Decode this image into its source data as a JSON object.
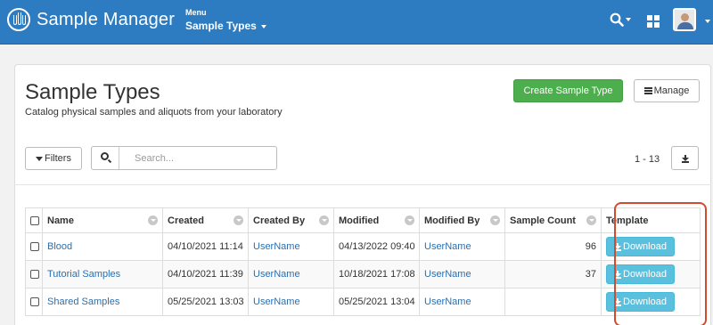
{
  "navbar": {
    "brand": "Sample Manager",
    "menu_label": "Menu",
    "menu_current": "Sample Types",
    "icons": [
      "search-icon",
      "apps-grid-icon",
      "user-avatar-icon"
    ]
  },
  "header": {
    "title": "Sample Types",
    "subtitle": "Catalog physical samples and aliquots from your laboratory",
    "create_button": "Create Sample Type",
    "manage_button": "Manage"
  },
  "toolbar": {
    "filters_label": "Filters",
    "search_placeholder": "Search...",
    "pagination": "1 - 13"
  },
  "table": {
    "columns": [
      "Name",
      "Created",
      "Created By",
      "Modified",
      "Modified By",
      "Sample Count",
      "Template"
    ],
    "rows": [
      {
        "name": "Blood",
        "created": "04/10/2021 11:14",
        "created_by": "UserName",
        "modified": "04/13/2022 09:40",
        "modified_by": "UserName",
        "sample_count": "96",
        "template": "Download"
      },
      {
        "name": "Tutorial Samples",
        "created": "04/10/2021 11:39",
        "created_by": "UserName",
        "modified": "10/18/2021 17:08",
        "modified_by": "UserName",
        "sample_count": "37",
        "template": "Download"
      },
      {
        "name": "Shared Samples",
        "created": "05/25/2021 13:03",
        "created_by": "UserName",
        "modified": "05/25/2021 13:04",
        "modified_by": "UserName",
        "sample_count": "",
        "template": "Download"
      }
    ]
  },
  "colors": {
    "navbar": "#2d7bc0",
    "create_button": "#4cae4c",
    "download_button": "#5bc0de",
    "link": "#2b6fae",
    "highlight": "#d24b2f"
  }
}
